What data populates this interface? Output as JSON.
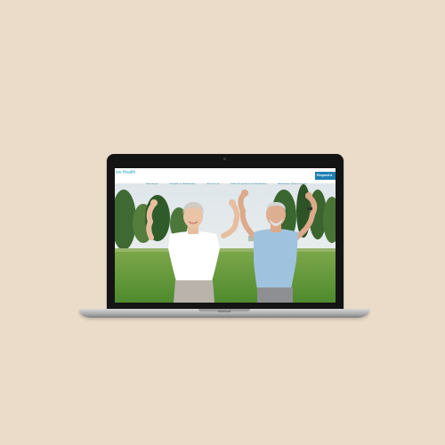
{
  "website": {
    "logo_text": "ive Health",
    "logo_tagline": "",
    "nav_items": [
      {
        "label": "Services"
      },
      {
        "label": "Health & Wellness"
      },
      {
        "label": "About Us"
      },
      {
        "label": "Why Functional Medicine"
      },
      {
        "label": "Wellness Resources"
      }
    ],
    "cta_label": "Request a"
  },
  "device": {
    "brand_label": "MacBook"
  },
  "colors": {
    "background": "#eadcc8",
    "accent": "#2aa6c6",
    "cta": "#1f7fb5",
    "nav_text": "#2a7fa3"
  }
}
